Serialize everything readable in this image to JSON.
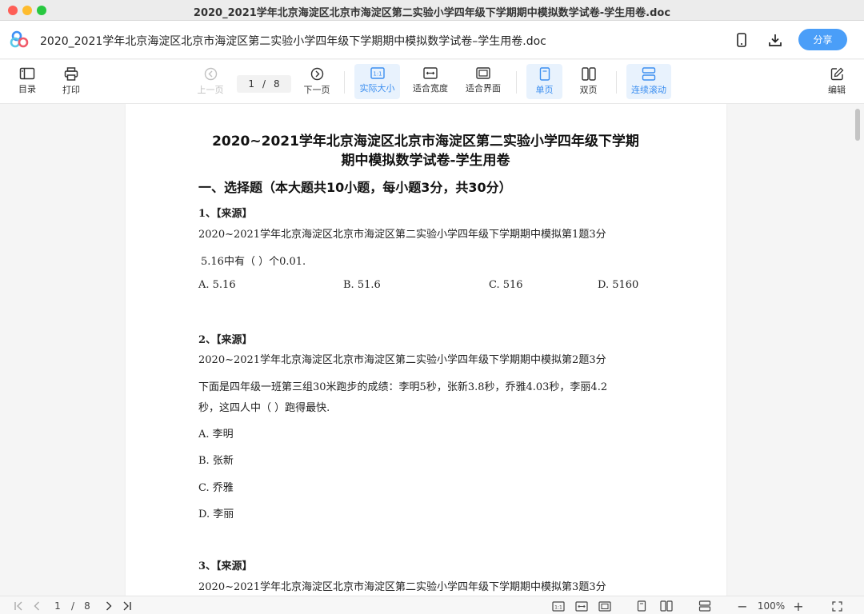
{
  "window": {
    "title": "2020_2021学年北京海淀区北京市海淀区第二实验小学四年级下学期期中模拟数学试卷-学生用卷.doc"
  },
  "header": {
    "doc_title": "2020_2021学年北京海淀区北京市海淀区第二实验小学四年级下学期期中模拟数学试卷–学生用卷.doc",
    "share_label": "分享",
    "icons": [
      "mobile-icon",
      "download-icon"
    ]
  },
  "toolbar": {
    "toc_label": "目录",
    "print_label": "打印",
    "prev_label": "上一页",
    "current_page": "1",
    "separator": "/",
    "total_pages": "8",
    "next_label": "下一页",
    "actual_size_label": "实际大小",
    "fit_width_label": "适合宽度",
    "fit_window_label": "适合界面",
    "single_page_label": "单页",
    "double_page_label": "双页",
    "continuous_label": "连续滚动",
    "edit_label": "编辑",
    "accent_color": "#3b8ef0"
  },
  "document": {
    "heading_line1": "2020~2021学年北京海淀区北京市海淀区第二实验小学四年级下学期",
    "heading_line2": "期中模拟数学试卷-学生用卷",
    "section_title": "一、选择题（本大题共10小题，每小题3分，共30分）",
    "questions": [
      {
        "num": "1、【来源】",
        "source": "2020~2021学年北京海淀区北京市海淀区第二实验小学四年级下学期期中模拟第1题3分",
        "stem": "5.16中有（   ）个0.01.",
        "options": [
          "A.  5.16",
          "B.  51.6",
          "C.  516",
          "D.  5160"
        ]
      },
      {
        "num": "2、【来源】",
        "source": "2020~2021学年北京海淀区北京市海淀区第二实验小学四年级下学期期中模拟第2题3分",
        "stem_line1": "下面是四年级一班第三组30米跑步的成绩：李明5秒，张新3.8秒，乔雅4.03秒，李丽4.2",
        "stem_line2": "秒，这四人中（   ）跑得最快.",
        "options": [
          "A.  李明",
          "B.  张新",
          "C.  乔雅",
          "D.  李丽"
        ]
      },
      {
        "num": "3、【来源】",
        "source": "2020~2021学年北京海淀区北京市海淀区第二实验小学四年级下学期期中模拟第3题3分"
      }
    ]
  },
  "statusbar": {
    "current_page": "1",
    "separator": "/",
    "total_pages": "8",
    "zoom": "100%",
    "zoom_out": "−",
    "zoom_in": "+"
  }
}
